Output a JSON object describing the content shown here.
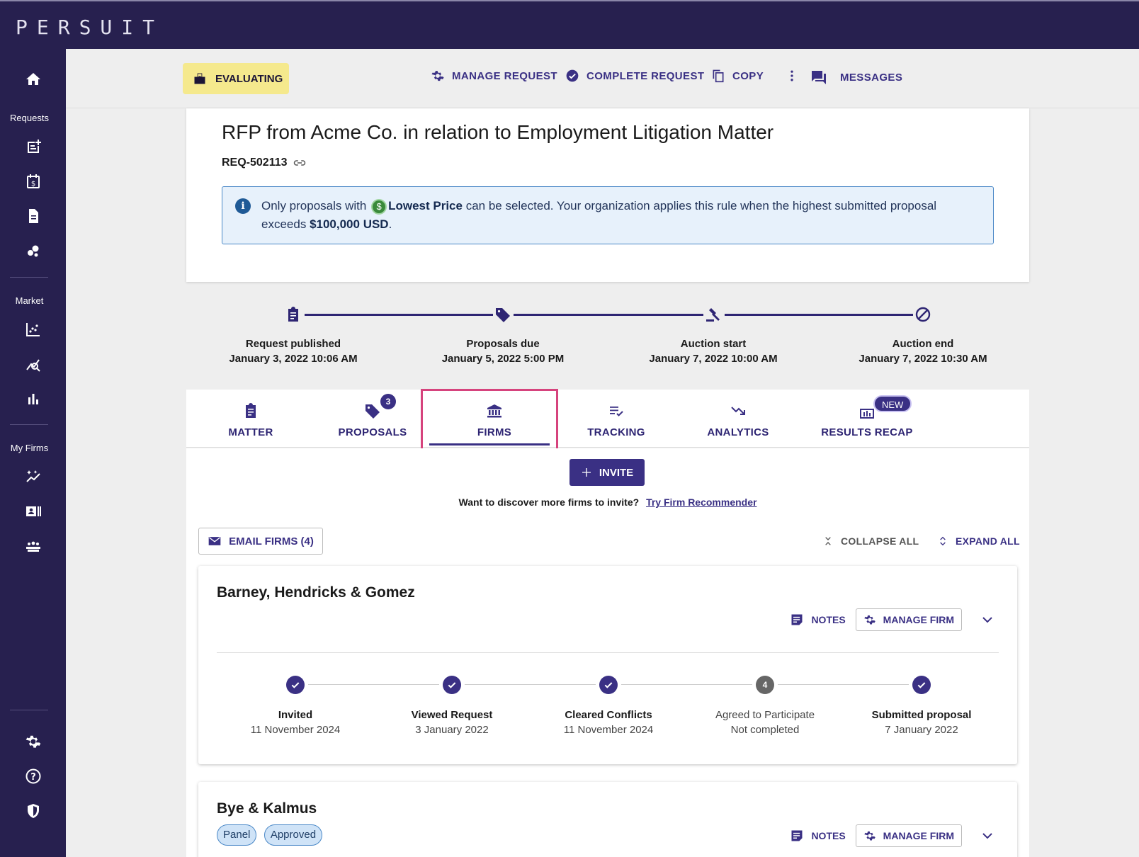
{
  "app": {
    "logo": "PERSUIT"
  },
  "sidebar": {
    "sections": [
      "Requests",
      "Market",
      "My Firms"
    ],
    "icons": [
      "home-icon",
      "new-request-icon",
      "billing-icon",
      "document-icon",
      "bubbles-icon",
      "scatter-chart-icon",
      "market-search-icon",
      "bar-chart-icon",
      "sparkle-chart-icon",
      "contact-card-icon",
      "team-icon",
      "settings-icon",
      "help-icon",
      "shield-icon"
    ]
  },
  "header": {
    "status": "EVALUATING",
    "actions": {
      "manage": "MANAGE REQUEST",
      "complete": "COMPLETE REQUEST",
      "copy": "COPY",
      "messages": "MESSAGES"
    }
  },
  "request": {
    "title": "RFP from Acme Co. in relation to Employment Litigation Matter",
    "id": "REQ-502113",
    "info": {
      "prefix": "Only proposals with",
      "badge": "Lowest Price",
      "middle": "can be selected. Your organization applies this rule when the highest submitted proposal exceeds",
      "amount": "$100,000 USD",
      "suffix": "."
    }
  },
  "timeline": [
    {
      "label": "Request published",
      "date": "January 3, 2022 10:06 AM",
      "icon": "clipboard-icon"
    },
    {
      "label": "Proposals due",
      "date": "January 5, 2022 5:00 PM",
      "icon": "tag-icon"
    },
    {
      "label": "Auction start",
      "date": "January 7, 2022 10:00 AM",
      "icon": "gavel-icon"
    },
    {
      "label": "Auction end",
      "date": "January 7, 2022 10:30 AM",
      "icon": "block-icon"
    }
  ],
  "tabs": [
    {
      "label": "MATTER"
    },
    {
      "label": "PROPOSALS",
      "badge": "3"
    },
    {
      "label": "FIRMS",
      "active": true
    },
    {
      "label": "TRACKING"
    },
    {
      "label": "ANALYTICS"
    },
    {
      "label": "RESULTS RECAP",
      "badge": "NEW"
    }
  ],
  "firms_tab": {
    "invite": "INVITE",
    "discover_text": "Want to discover more firms to invite?",
    "discover_link": "Try Firm Recommender",
    "email_firms": "EMAIL FIRMS (4)",
    "collapse_all": "COLLAPSE ALL",
    "expand_all": "EXPAND ALL",
    "notes": "NOTES",
    "manage_firm": "MANAGE FIRM",
    "firms": [
      {
        "name": "Barney, Hendricks & Gomez",
        "steps": [
          {
            "label": "Invited",
            "value": "11 November 2024",
            "done": true
          },
          {
            "label": "Viewed Request",
            "value": "3 January 2022",
            "done": true
          },
          {
            "label": "Cleared Conflicts",
            "value": "11 November 2024",
            "done": true
          },
          {
            "label": "Agreed to Participate",
            "value": "Not completed",
            "done": false,
            "number": "4"
          },
          {
            "label": "Submitted proposal",
            "value": "7 January 2022",
            "done": true
          }
        ]
      },
      {
        "name": "Bye & Kalmus",
        "tags": [
          "Panel",
          "Approved"
        ]
      }
    ]
  },
  "colors": {
    "primary": "#3a3084",
    "nav": "#27204f",
    "status_chip": "#f5e98d",
    "highlight": "#d6437d"
  }
}
